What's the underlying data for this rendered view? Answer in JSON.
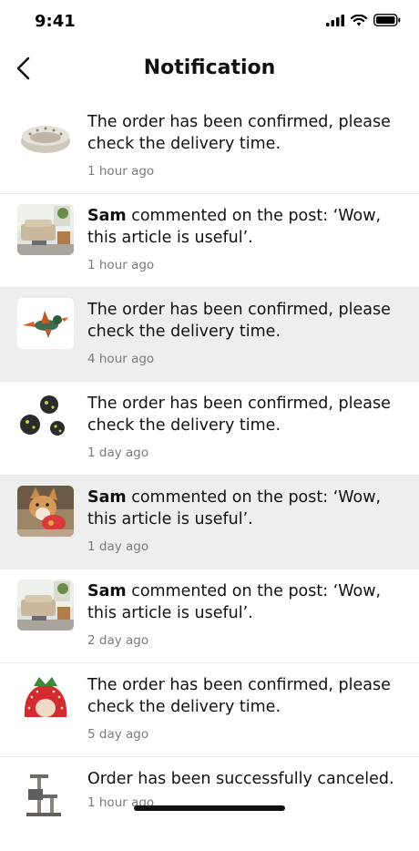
{
  "status_bar": {
    "time": "9:41"
  },
  "header": {
    "title": "Notification"
  },
  "notifications": [
    {
      "author": "",
      "message": "The order has been confirmed, please check the delivery time.",
      "time": "1 hour ago",
      "thumbnail": "pet-bed-thumbnail"
    },
    {
      "author": "Sam",
      "message": " commented on the post: ‘Wow, this article is useful’.",
      "time": "1 hour ago",
      "thumbnail": "living-room-thumbnail"
    },
    {
      "author": "",
      "message": "The order has been confirmed, please check the delivery time.",
      "time": "4 hour ago",
      "thumbnail": "duck-toy-thumbnail"
    },
    {
      "author": "",
      "message": "The order has been confirmed, please check the delivery time.",
      "time": "1 day ago",
      "thumbnail": "balls-thumbnail"
    },
    {
      "author": "Sam",
      "message": " commented on the post: ‘Wow, this article is useful’.",
      "time": "1 day ago",
      "thumbnail": "puppy-thumbnail"
    },
    {
      "author": "Sam",
      "message": " commented on the post: ‘Wow, this article is useful’.",
      "time": "2 day ago",
      "thumbnail": "living-room-thumbnail"
    },
    {
      "author": "",
      "message": "The order has been confirmed, please check the delivery time.",
      "time": "5 day ago",
      "thumbnail": "strawberry-house-thumbnail"
    },
    {
      "author": "",
      "message": "Order has been successfully canceled.",
      "time": "1 hour ago",
      "thumbnail": "cat-tree-thumbnail"
    }
  ]
}
